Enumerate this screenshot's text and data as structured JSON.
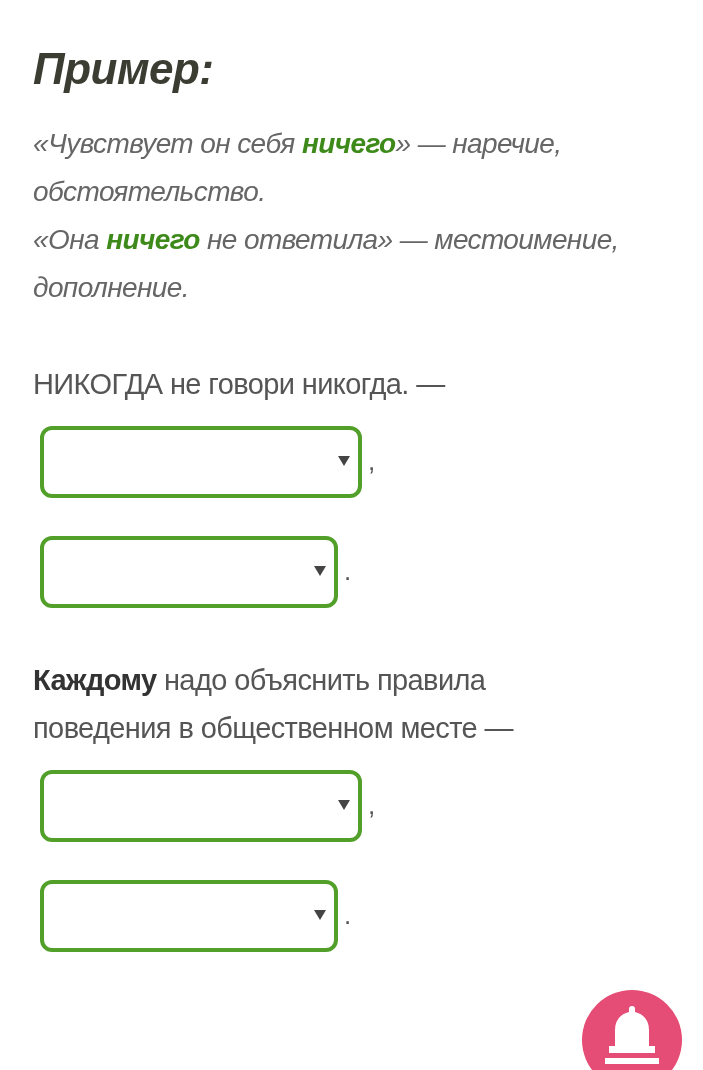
{
  "heading": "Пример:",
  "examples": [
    "«Чувствует он себя **ничего**» — наречие, обстоятельство.",
    "«Она **ничего** не ответила» — местоимение, дополнение."
  ],
  "tasks": [
    {
      "sentence": "НИКОГДА не говори никогда. —",
      "blanks": [
        {
          "after": ","
        },
        {
          "after": "."
        }
      ]
    },
    {
      "sentence": "**Каждому** надо объяснить правила поведения в общественном месте —",
      "blanks": [
        {
          "after": ","
        },
        {
          "after": "."
        }
      ]
    }
  ]
}
